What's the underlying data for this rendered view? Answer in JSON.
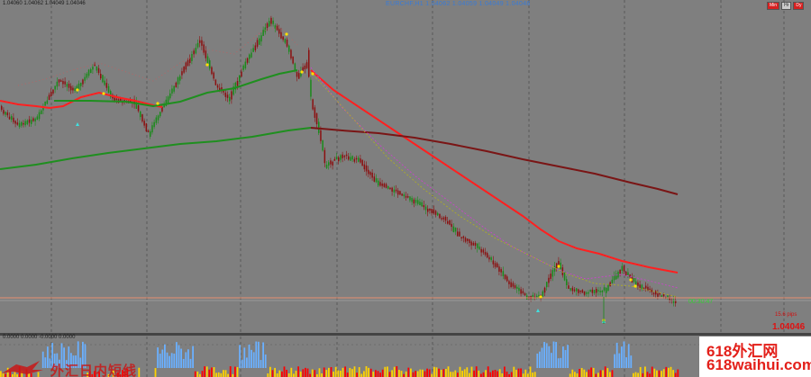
{
  "chart": {
    "symbol_label": "EURCHF,H1  1.04062 1.04059 1.04049 1.04046",
    "ohlc_label": "1.04060 1.04062 1.04049 1.04046",
    "indicator_label": "0.0000 0.0000 -0.0000 0.0000",
    "time_remaining": "00:30:47",
    "spread": "15.6 pips",
    "bid_price": "1.04046",
    "timeframe_buttons": [
      "Min",
      "Hr",
      "Dy"
    ]
  },
  "watermark": {
    "right_line1": "618外汇网",
    "right_line2": "618waihui.com",
    "left_text": "外汇日内短线"
  },
  "colors": {
    "background": "#7f7f7f",
    "bull_candle": "#1a8a1a",
    "bear_candle": "#8b1010",
    "ma_fast": "#ff2020",
    "ma_mid": "#1f8f1f",
    "ma_slow": "#7a1515",
    "ma_dotted": "#d040d0",
    "support_line": "#e89070",
    "bid_line": "#a0a0a0",
    "hist_red": "#ff0000",
    "hist_yellow": "#ffd200",
    "hist_blue": "#6ab0ff"
  },
  "icons": {
    "watermark_logo": "red-eagle-logo"
  }
}
